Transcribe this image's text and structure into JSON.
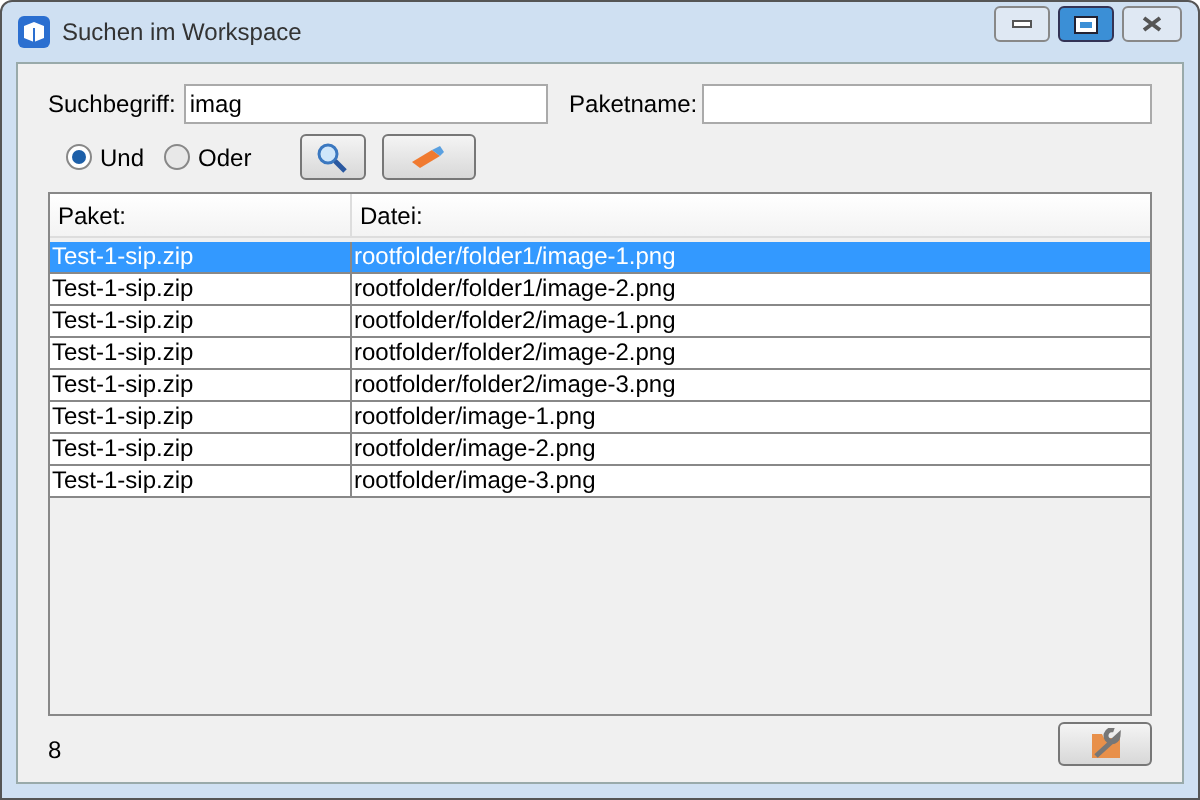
{
  "window": {
    "title": "Suchen im Workspace"
  },
  "search": {
    "label": "Suchbegriff:",
    "value": "imag"
  },
  "package": {
    "label": "Paketname:"
  },
  "mode": [
    {
      "label": "Und",
      "selected": true
    },
    {
      "label": "Oder",
      "selected": false
    }
  ],
  "table": {
    "columns": [
      "Paket:",
      "Datei:"
    ],
    "rows": [
      {
        "cells": [
          "Test-1-sip.zip",
          "rootfolder/folder1/image-1.png"
        ],
        "selected": true
      },
      {
        "cells": [
          "Test-1-sip.zip",
          "rootfolder/folder1/image-2.png"
        ],
        "selected": false
      },
      {
        "cells": [
          "Test-1-sip.zip",
          "rootfolder/folder2/image-1.png"
        ],
        "selected": false
      },
      {
        "cells": [
          "Test-1-sip.zip",
          "rootfolder/folder2/image-2.png"
        ],
        "selected": false
      },
      {
        "cells": [
          "Test-1-sip.zip",
          "rootfolder/folder2/image-3.png"
        ],
        "selected": false
      },
      {
        "cells": [
          "Test-1-sip.zip",
          "rootfolder/image-1.png"
        ],
        "selected": false
      },
      {
        "cells": [
          "Test-1-sip.zip",
          "rootfolder/image-2.png"
        ],
        "selected": false
      },
      {
        "cells": [
          "Test-1-sip.zip",
          "rootfolder/image-3.png"
        ],
        "selected": false
      }
    ]
  },
  "status": {
    "count": "8"
  }
}
